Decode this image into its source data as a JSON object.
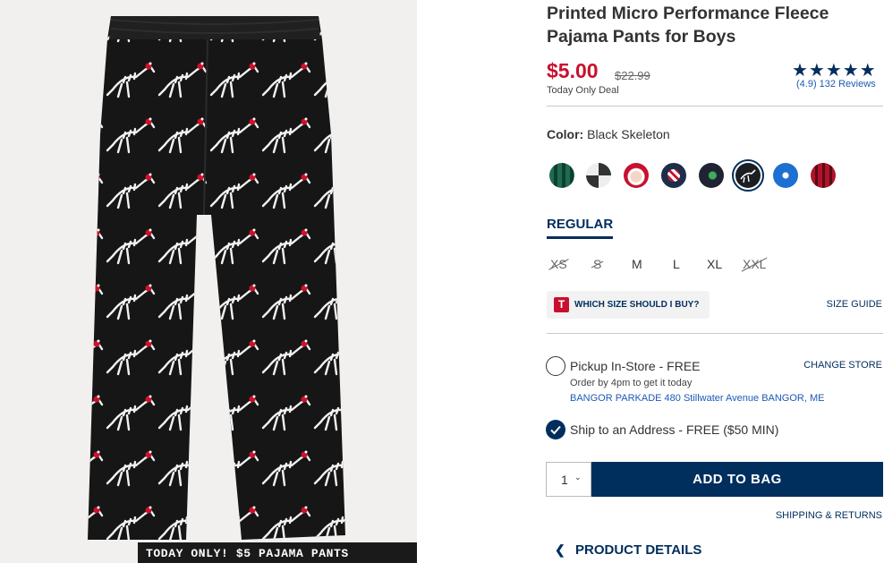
{
  "product": {
    "title": "Printed Micro Performance Fleece Pajama Pants for Boys",
    "price": "$5.00",
    "original_price": "$22.99",
    "deal_text": "Today Only Deal",
    "stars": "★★★★★",
    "reviews": "(4.9) 132 Reviews"
  },
  "color": {
    "label": "Color:",
    "selected": "Black Skeleton",
    "swatches": [
      {
        "name": "green plaid",
        "color": "#1f6b52"
      },
      {
        "name": "gray buffalo check",
        "color": "#8a8a8a"
      },
      {
        "name": "santa",
        "color": "#eeeeee"
      },
      {
        "name": "candy cane",
        "color": "#c8102e"
      },
      {
        "name": "navy",
        "color": "#1c2e4a"
      },
      {
        "name": "dinosaur",
        "color": "#1e2433"
      },
      {
        "name": "black skeleton",
        "color": "#1b1f24"
      },
      {
        "name": "blue nutcracker",
        "color": "#1d6fd1"
      },
      {
        "name": "red plaid",
        "color": "#b0132b"
      }
    ]
  },
  "fit": {
    "tab": "REGULAR"
  },
  "sizes": [
    {
      "label": "XS",
      "available": false
    },
    {
      "label": "S",
      "available": false
    },
    {
      "label": "M",
      "available": true
    },
    {
      "label": "L",
      "available": true
    },
    {
      "label": "XL",
      "available": true
    },
    {
      "label": "XXL",
      "available": false
    }
  ],
  "size_help": {
    "icon_letter": "T",
    "label": "WHICH SIZE SHOULD I BUY?",
    "guide": "SIZE GUIDE"
  },
  "fulfillment": {
    "pickup_label": "Pickup In-Store - FREE",
    "change_store": "CHANGE STORE",
    "order_by": "Order by 4pm to get it today",
    "store": "BANGOR PARKADE 480 Stillwater Avenue  BANGOR, ME",
    "ship_label": "Ship to an Address - FREE ($50 MIN)"
  },
  "cart": {
    "quantity": "1",
    "add_button": "ADD TO BAG",
    "shipping_link": "SHIPPING & RETURNS"
  },
  "details": {
    "label": "PRODUCT DETAILS"
  },
  "promo": {
    "text": "TODAY ONLY! $5 PAJAMA PANTS"
  },
  "colors": {
    "navy": "#002e5d",
    "sale_red": "#c8102e",
    "link_blue": "#1d5bb5"
  }
}
